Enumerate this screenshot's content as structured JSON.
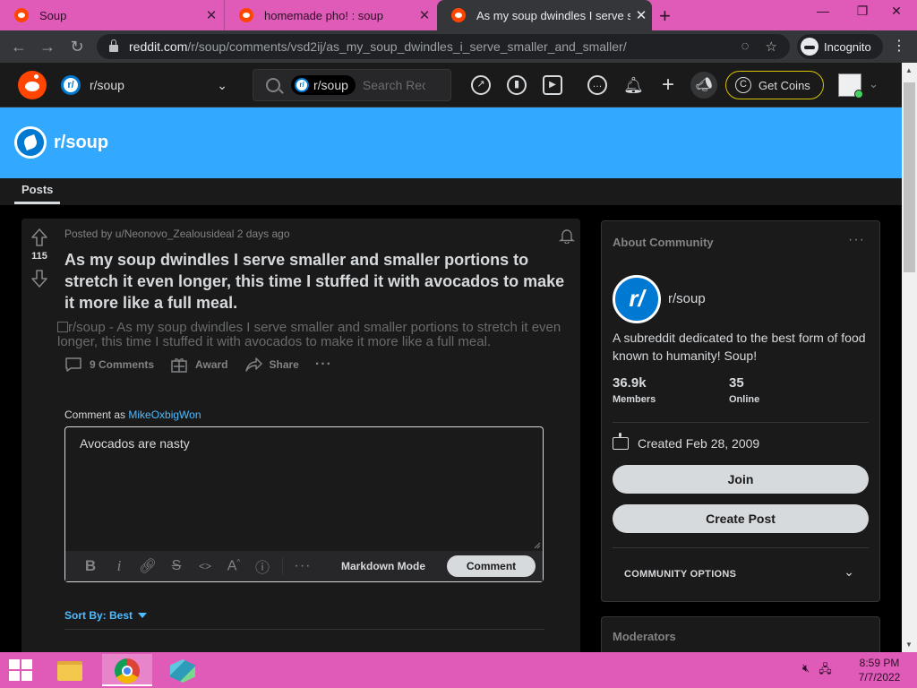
{
  "browser": {
    "tabs": [
      {
        "title": "Soup"
      },
      {
        "title": "homemade pho! : soup"
      },
      {
        "title": "As my soup dwindles I serve sma"
      }
    ],
    "url_host": "reddit.com",
    "url_path": "/r/soup/comments/vsd2ij/as_my_soup_dwindles_i_serve_smaller_and_smaller/",
    "incognito_label": "Incognito"
  },
  "header": {
    "community": "r/soup",
    "search_chip": "r/soup",
    "search_placeholder": "Search Rec",
    "coins_label": "Get Coins",
    "icons": [
      "popular-icon",
      "stats-icon",
      "video-icon",
      "chat-icon",
      "notification-icon",
      "plus-icon",
      "advertise-icon"
    ]
  },
  "banner": {
    "name": "r/soup",
    "color": "#33a8ff"
  },
  "tabs": {
    "posts": "Posts"
  },
  "post": {
    "votes": "115",
    "meta": "Posted by u/Neonovo_Zealousideal 2 days ago",
    "title": "As my soup dwindles I serve smaller and smaller portions to stretch it even longer, this time I stuffed it with avocados to make it more like a full meal.",
    "image_alt": "r/soup - As my soup dwindles I serve smaller and smaller portions to stretch it even longer, this time I stuffed it with avocados to make it more like a full meal.",
    "actions": {
      "comments": "9 Comments",
      "award": "Award",
      "share": "Share"
    }
  },
  "comment": {
    "prefix": "Comment as",
    "user": "MikeOxbigWon",
    "text": "Avocados are nasty",
    "markdown_mode": "Markdown Mode",
    "submit": "Comment"
  },
  "sort": {
    "label": "Sort By: Best"
  },
  "sidebar": {
    "about_title": "About Community",
    "name": "r/soup",
    "description": "A subreddit dedicated to the best form of food known to humanity! Soup!",
    "members_value": "36.9k",
    "members_label": "Members",
    "online_value": "35",
    "online_label": "Online",
    "created": "Created Feb 28, 2009",
    "join": "Join",
    "create_post": "Create Post",
    "community_options": "COMMUNITY OPTIONS",
    "moderators_title": "Moderators"
  },
  "taskbar": {
    "time": "8:59 PM",
    "date": "7/7/2022"
  }
}
